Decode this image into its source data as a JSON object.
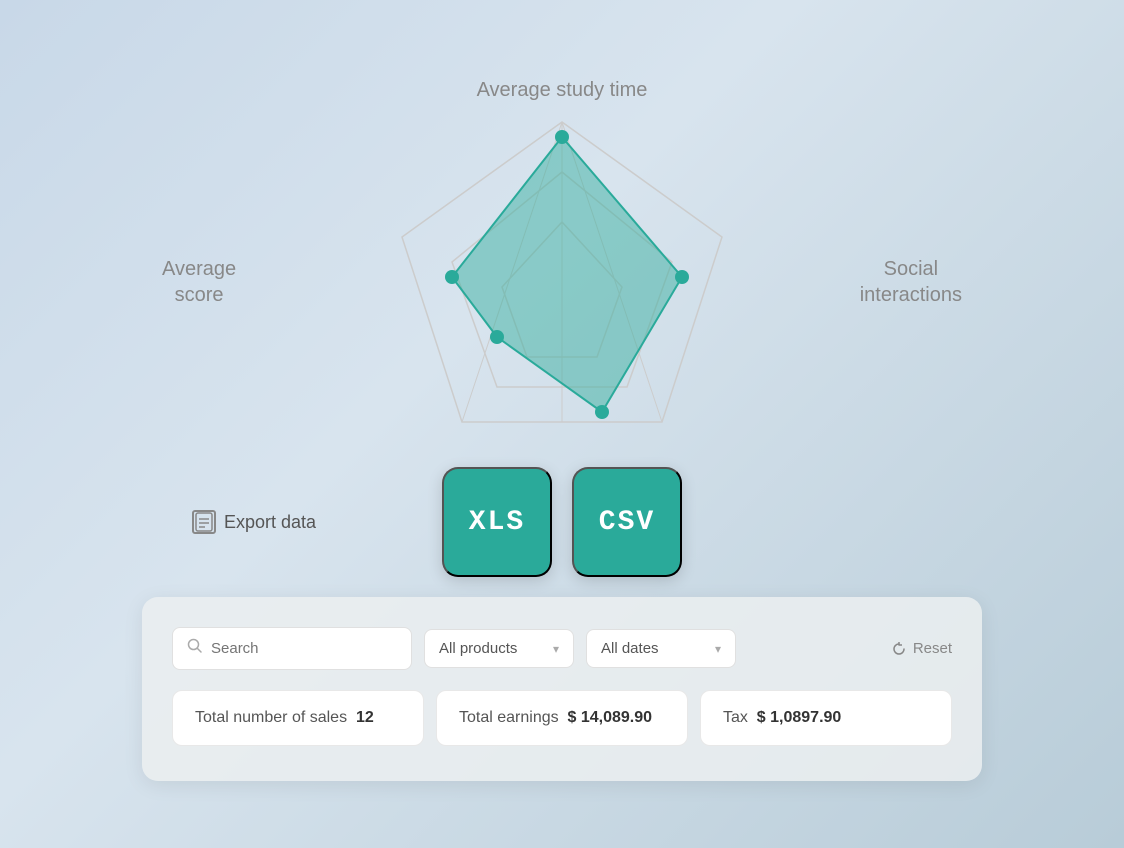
{
  "radar": {
    "label_top": "Average study time",
    "label_left_line1": "Average",
    "label_left_line2": "score",
    "label_right_line1": "Social",
    "label_right_line2": "interactions",
    "color": "#2aaa9a"
  },
  "export": {
    "label": "Export data",
    "xls_label": "XLS",
    "csv_label": "CSV"
  },
  "filters": {
    "search_placeholder": "Search",
    "products_label": "All products",
    "dates_label": "All dates",
    "reset_label": "Reset"
  },
  "stats": {
    "sales_label": "Total number of sales",
    "sales_value": "12",
    "earnings_label": "Total earnings",
    "earnings_value": "$ 14,089.90",
    "tax_label": "Tax",
    "tax_value": "$ 1,0897.90"
  }
}
